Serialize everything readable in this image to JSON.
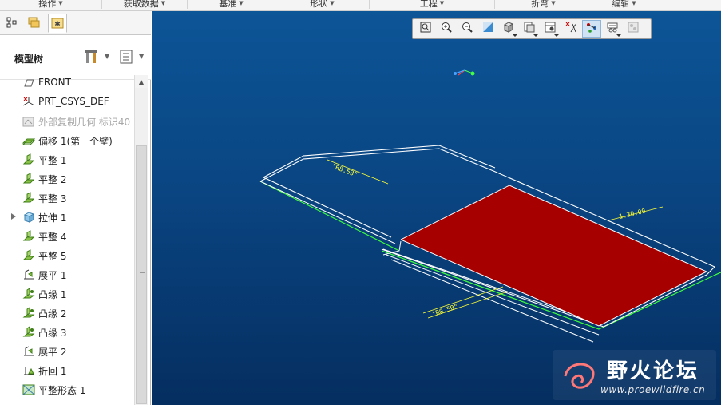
{
  "ribbon": {
    "groups": [
      {
        "label": "操作",
        "w": 128
      },
      {
        "label": "获取数据",
        "w": 107
      },
      {
        "label": "基准",
        "w": 110
      },
      {
        "label": "形状",
        "w": 118
      },
      {
        "label": "工程",
        "w": 157
      },
      {
        "label": "折弯",
        "w": 122
      },
      {
        "label": "编辑",
        "w": 80
      }
    ]
  },
  "panel": {
    "title": "模型树"
  },
  "tree": {
    "items": [
      {
        "label": "FRONT",
        "icon": "datum-plane-icon"
      },
      {
        "label": "PRT_CSYS_DEF",
        "icon": "csys-icon"
      },
      {
        "label": "外部复制几何 标识40",
        "icon": "external-copy-geom-icon",
        "dim": true
      },
      {
        "label": "偏移 1(第一个壁)",
        "icon": "offset-wall-icon"
      },
      {
        "label": "平整 1",
        "icon": "flat-wall-icon"
      },
      {
        "label": "平整 2",
        "icon": "flat-wall-icon"
      },
      {
        "label": "平整 3",
        "icon": "flat-wall-icon"
      },
      {
        "label": "拉伸 1",
        "icon": "extrude-icon",
        "expandable": true
      },
      {
        "label": "平整 4",
        "icon": "flat-wall-icon"
      },
      {
        "label": "平整 5",
        "icon": "flat-wall-icon"
      },
      {
        "label": "展平 1",
        "icon": "unbend-icon"
      },
      {
        "label": "凸缘 1",
        "icon": "flange-icon"
      },
      {
        "label": "凸缘 2",
        "icon": "flange-icon"
      },
      {
        "label": "凸缘 3",
        "icon": "flange-icon"
      },
      {
        "label": "展平 2",
        "icon": "unbend-icon"
      },
      {
        "label": "折回 1",
        "icon": "bendback-icon"
      },
      {
        "label": "平整形态 1",
        "icon": "flat-pattern-icon"
      }
    ]
  },
  "viewport": {
    "toolbar": [
      "refit-icon",
      "zoom-in-icon",
      "zoom-out-icon",
      "repaint-icon",
      "display-style-icon",
      "saved-views-icon",
      "view-manager-icon",
      "datum-display-icon",
      "spin-center-icon",
      "annotation-display-icon",
      "appearance-icon"
    ],
    "active_tool": "spin-center-icon",
    "dimensions": [
      "\"R8.53\"",
      "1.30.00",
      "\"R0.50\""
    ],
    "watermark": {
      "title": "野火论坛",
      "url": "www.proewildfire.cn"
    }
  },
  "colors": {
    "viewport_top": "#0c5597",
    "viewport_bottom": "#052e60",
    "sheet_fill": "#a70000",
    "edge_white": "#ffffff",
    "edge_green": "#3dff3d",
    "dim_yellow": "#ffff33"
  }
}
